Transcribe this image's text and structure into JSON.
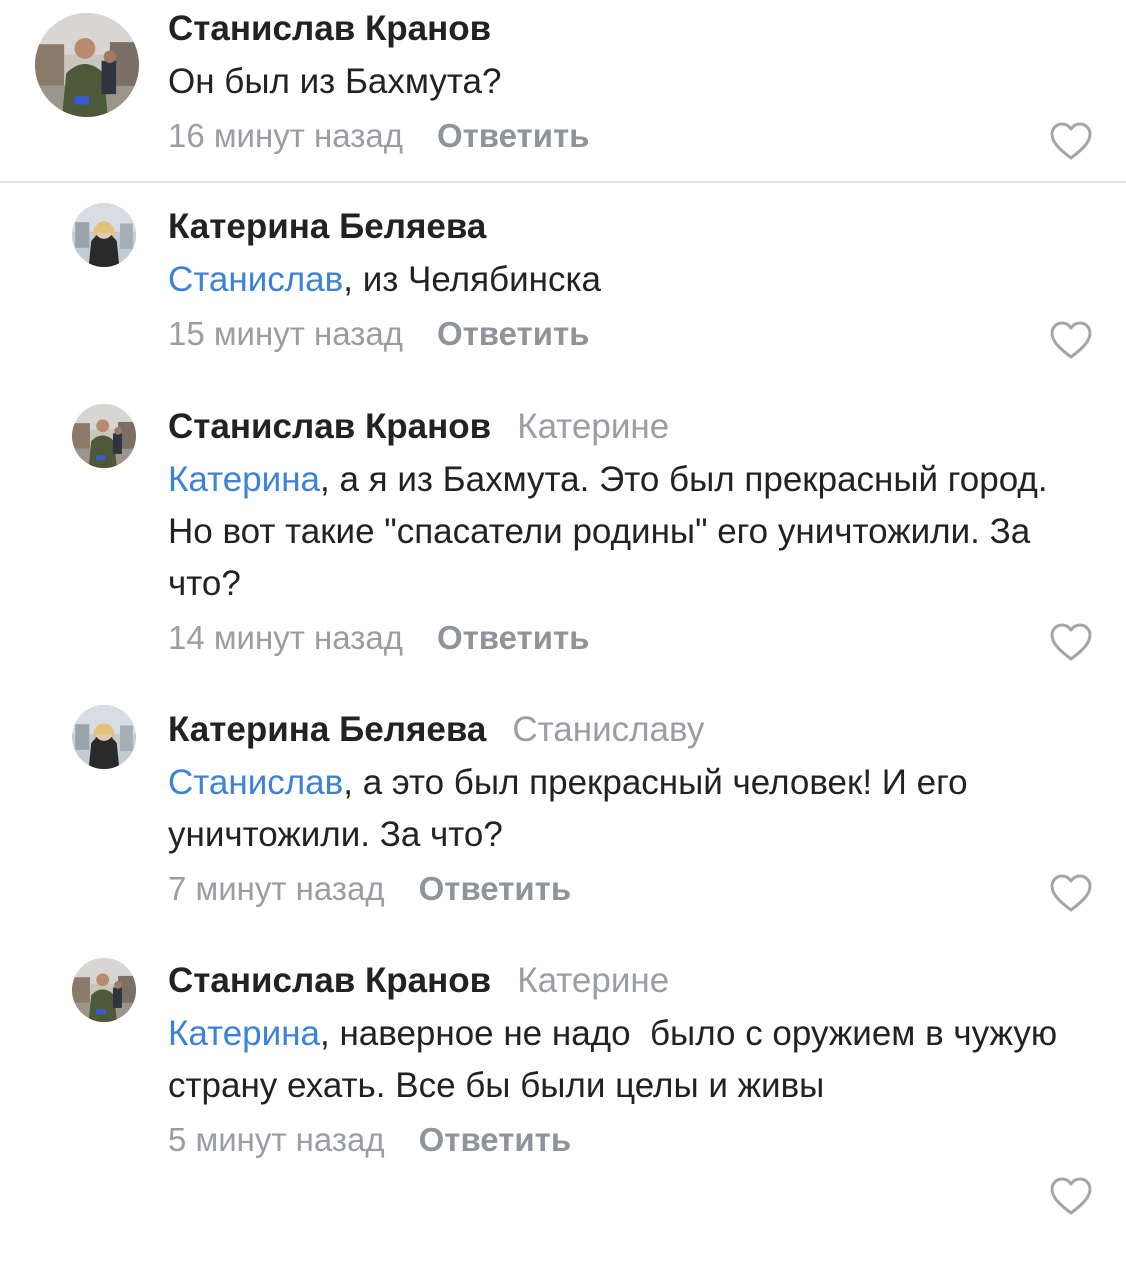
{
  "comments": [
    {
      "author": "Станислав Кранов",
      "reply_to": "",
      "mention": "",
      "text": "Он был из Бахмута?",
      "time": "16 минут назад",
      "reply_label": "Ответить",
      "like_icon": "heart-outline-icon"
    },
    {
      "author": "Катерина Беляева",
      "reply_to": "",
      "mention": "Станислав",
      "text": ", из Челябинска",
      "time": "15 минут назад",
      "reply_label": "Ответить",
      "like_icon": "heart-outline-icon"
    },
    {
      "author": "Станислав Кранов",
      "reply_to": "Катерине",
      "mention": "Катерина",
      "text": ", а я из Бахмута. Это был прекрасный город. Но вот такие \"спасатели родины\" его уничтожили. За что?",
      "time": "14 минут назад",
      "reply_label": "Ответить",
      "like_icon": "heart-outline-icon"
    },
    {
      "author": "Катерина Беляева",
      "reply_to": "Станиславу",
      "mention": "Станислав",
      "text": ", а это был прекрасный человек! И его уничтожили. За что?",
      "time": "7 минут назад",
      "reply_label": "Ответить",
      "like_icon": "heart-outline-icon"
    },
    {
      "author": "Станислав Кранов",
      "reply_to": "Катерине",
      "mention": "Катерина",
      "text": ", наверное не надо  было с оружием в чужую страну ехать. Все бы были целы и живы",
      "time": "5 минут назад",
      "reply_label": "Ответить",
      "like_icon": "heart-outline-icon"
    }
  ],
  "colors": {
    "mention": "#3b82d8",
    "secondary_text": "#9a9ea3",
    "reply_button": "#8f949a",
    "primary_text": "#222222",
    "heart_outline": "#a2a6ab",
    "divider": "#e3e4e6"
  }
}
